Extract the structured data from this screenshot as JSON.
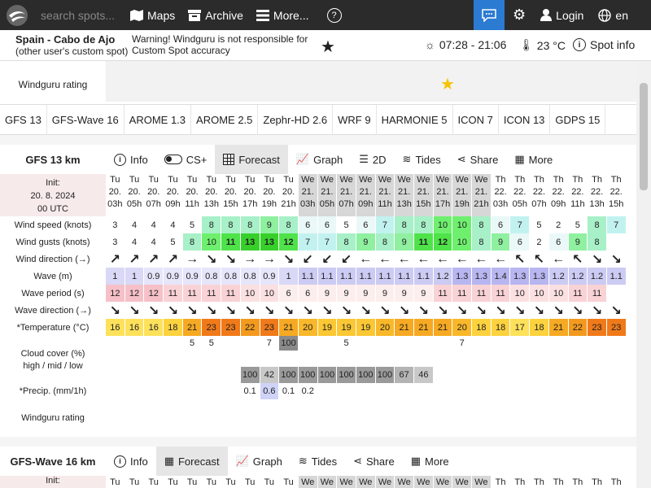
{
  "nav": {
    "search_placeholder": "search spots...",
    "maps": "Maps",
    "archive": "Archive",
    "more": "More...",
    "help": "?",
    "login": "Login",
    "lang": "en"
  },
  "spot": {
    "name": "Spain - Cabo de Ajo",
    "sub": "(other user's custom spot)",
    "warning": "Warning! Windguru is not responsible for Custom Spot accuracy",
    "sun": "07:28 - 21:06",
    "temp": "23 °C",
    "spot_info": "Spot info"
  },
  "partial": {
    "precip_fragment": "*Precip. (mm/1h)",
    "rating_label": "Windguru rating"
  },
  "model_tabs": [
    "GFS 13",
    "GFS-Wave 16",
    "AROME 1.3",
    "AROME 2.5",
    "Zephr-HD 2.6",
    "WRF 9",
    "HARMONIE 5",
    "ICON 7",
    "ICON 13",
    "GDPS 15"
  ],
  "forecast": {
    "title": "GFS 13 km",
    "tabs": {
      "info": "Info",
      "cs": "CS+",
      "forecast": "Forecast",
      "graph": "Graph",
      "twod": "2D",
      "tides": "Tides",
      "share": "Share",
      "more": "More"
    },
    "init_label": "Init:",
    "init_date": "20. 8. 2024",
    "init_time": "00 UTC",
    "days": [
      "Tu",
      "Tu",
      "Tu",
      "Tu",
      "Tu",
      "Tu",
      "Tu",
      "Tu",
      "Tu",
      "Tu",
      "We",
      "We",
      "We",
      "We",
      "We",
      "We",
      "We",
      "We",
      "We",
      "We",
      "Th",
      "Th",
      "Th",
      "Th",
      "Th",
      "Th",
      "Th"
    ],
    "dates": [
      "20.",
      "20.",
      "20.",
      "20.",
      "20.",
      "20.",
      "20.",
      "20.",
      "20.",
      "20.",
      "21.",
      "21.",
      "21.",
      "21.",
      "21.",
      "21.",
      "21.",
      "21.",
      "21.",
      "21.",
      "22.",
      "22.",
      "22.",
      "22.",
      "22.",
      "22.",
      "22."
    ],
    "hours": [
      "03h",
      "05h",
      "07h",
      "09h",
      "11h",
      "13h",
      "15h",
      "17h",
      "19h",
      "21h",
      "03h",
      "05h",
      "07h",
      "09h",
      "11h",
      "13h",
      "15h",
      "17h",
      "19h",
      "21h",
      "03h",
      "05h",
      "07h",
      "09h",
      "11h",
      "13h",
      "15h"
    ],
    "labels": {
      "wind_speed": "Wind speed (knots)",
      "wind_gusts": "Wind gusts (knots)",
      "wind_dir": "Wind direction (→)",
      "wave": "Wave (m)",
      "wave_period": "Wave period (s)",
      "wave_dir": "Wave direction (→)",
      "temperature": "*Temperature (°C)",
      "cloud1": "Cloud cover (%)",
      "cloud2": "high / mid / low",
      "precip": "*Precip. (mm/1h)",
      "rating": "Windguru rating"
    },
    "wind_speed": [
      "3",
      "4",
      "4",
      "4",
      "5",
      "8",
      "8",
      "8",
      "9",
      "8",
      "6",
      "6",
      "5",
      "6",
      "7",
      "8",
      "8",
      "10",
      "10",
      "8",
      "6",
      "7",
      "5",
      "2",
      "5",
      "8",
      "7"
    ],
    "wind_gusts": [
      "3",
      "4",
      "4",
      "5",
      "8",
      "10",
      "11",
      "13",
      "13",
      "12",
      "7",
      "7",
      "8",
      "9",
      "8",
      "9",
      "11",
      "12",
      "10",
      "8",
      "9",
      "6",
      "2",
      "6",
      "9",
      "8",
      ""
    ],
    "wind_dir": [
      "↗",
      "↗",
      "↗",
      "↗",
      "→",
      "↘",
      "↘",
      "→",
      "→",
      "↘",
      "↙",
      "↙",
      "↙",
      "←",
      "←",
      "←",
      "←",
      "←",
      "←",
      "←",
      "←",
      "↖",
      "↖",
      "←",
      "↖",
      "↘",
      "↘"
    ],
    "wave": [
      "1",
      "1",
      "0.9",
      "0.9",
      "0.9",
      "0.8",
      "0.8",
      "0.8",
      "0.9",
      "1",
      "1.1",
      "1.1",
      "1.1",
      "1.1",
      "1.1",
      "1.1",
      "1.1",
      "1.2",
      "1.3",
      "1.3",
      "1.4",
      "1.3",
      "1.3",
      "1.2",
      "1.2",
      "1.2",
      "1.1"
    ],
    "wave_period": [
      "12",
      "12",
      "12",
      "11",
      "11",
      "11",
      "11",
      "10",
      "10",
      "6",
      "6",
      "9",
      "9",
      "9",
      "9",
      "9",
      "9",
      "11",
      "11",
      "11",
      "11",
      "10",
      "10",
      "10",
      "11",
      "11",
      ""
    ],
    "wave_dir": [
      "↘",
      "↘",
      "↘",
      "↘",
      "↘",
      "↘",
      "↘",
      "↘",
      "↘",
      "↘",
      "↘",
      "↘",
      "↘",
      "↘",
      "↘",
      "↘",
      "↘",
      "↘",
      "↘",
      "↘",
      "↘",
      "↘",
      "↘",
      "↘",
      "↘",
      "↘",
      "↘"
    ],
    "temperature": [
      "16",
      "16",
      "16",
      "18",
      "21",
      "23",
      "23",
      "22",
      "23",
      "21",
      "20",
      "19",
      "19",
      "19",
      "20",
      "21",
      "21",
      "21",
      "20",
      "18",
      "18",
      "17",
      "18",
      "21",
      "22",
      "23",
      "23"
    ],
    "cloud_high": [
      "",
      "",
      "",
      "",
      "5",
      "5",
      "",
      "",
      "7",
      "100",
      "",
      "",
      "5",
      "",
      "",
      "",
      "",
      "",
      "7",
      "",
      "",
      "",
      "",
      "",
      "",
      "",
      ""
    ],
    "cloud_low": [
      "",
      "",
      "",
      "",
      "",
      "",
      "",
      "100",
      "42",
      "100",
      "100",
      "100",
      "100",
      "100",
      "100",
      "67",
      "46",
      "",
      "",
      "",
      "",
      "",
      "",
      "",
      "",
      "",
      ""
    ],
    "precip": [
      "",
      "",
      "",
      "",
      "",
      "",
      "",
      "0.1",
      "0.6",
      "0.1",
      "0.2",
      "",
      "",
      "",
      "",
      "",
      "",
      "",
      "",
      "",
      "",
      "",
      "",
      "",
      "",
      "",
      ""
    ]
  },
  "wave_section": {
    "title": "GFS-Wave 16 km",
    "tabs": {
      "info": "Info",
      "forecast": "Forecast",
      "graph": "Graph",
      "tides": "Tides",
      "share": "Share",
      "more": "More"
    },
    "init_label": "Init:",
    "days": [
      "Tu",
      "Tu",
      "Tu",
      "Tu",
      "Tu",
      "Tu",
      "Tu",
      "Tu",
      "Tu",
      "Tu",
      "We",
      "We",
      "We",
      "We",
      "We",
      "We",
      "We",
      "We",
      "We",
      "We",
      "Th",
      "Th",
      "Th",
      "Th",
      "Th",
      "Th",
      "Th"
    ]
  },
  "colors": {
    "topbar": "#2b2b2b",
    "accent": "#2b7bd3",
    "weekend_hdr": "#d7d7d7",
    "init_bg": "#f7eaea",
    "star": "#f5c400"
  }
}
